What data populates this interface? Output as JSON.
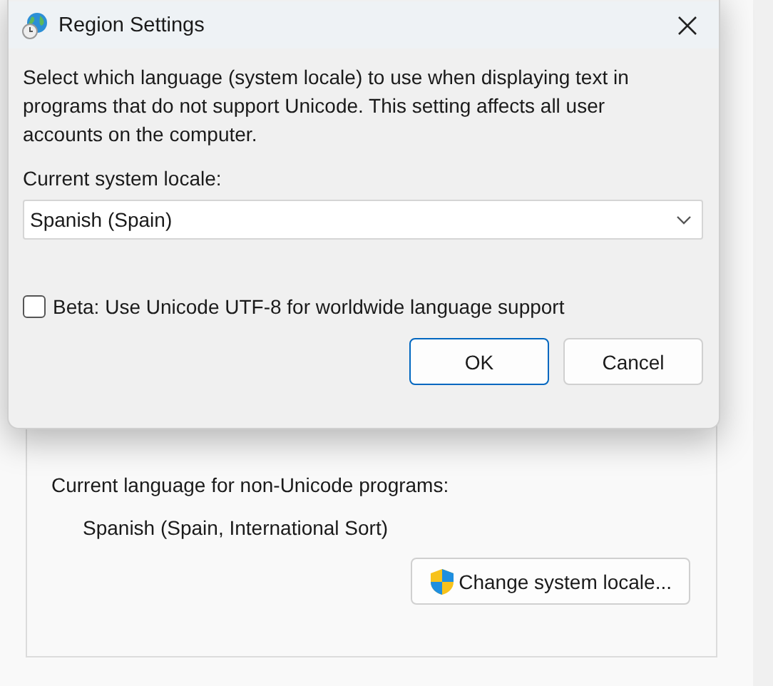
{
  "background_window": {
    "current_language_label": "Current language for non-Unicode programs:",
    "current_language_value": "Spanish (Spain, International Sort)",
    "change_button": {
      "label": "Change system locale..."
    }
  },
  "dialog": {
    "title": "Region Settings",
    "description": "Select which language (system locale) to use when displaying text in programs that do not support Unicode. This setting affects all user accounts on the computer.",
    "locale_label": "Current system locale:",
    "locale_dropdown": {
      "value": "Spanish (Spain)"
    },
    "checkbox": {
      "label": "Beta: Use Unicode UTF-8 for worldwide language support",
      "checked": false
    },
    "buttons": [
      {
        "label": "OK",
        "default": true
      },
      {
        "label": "Cancel",
        "default": false
      }
    ]
  }
}
